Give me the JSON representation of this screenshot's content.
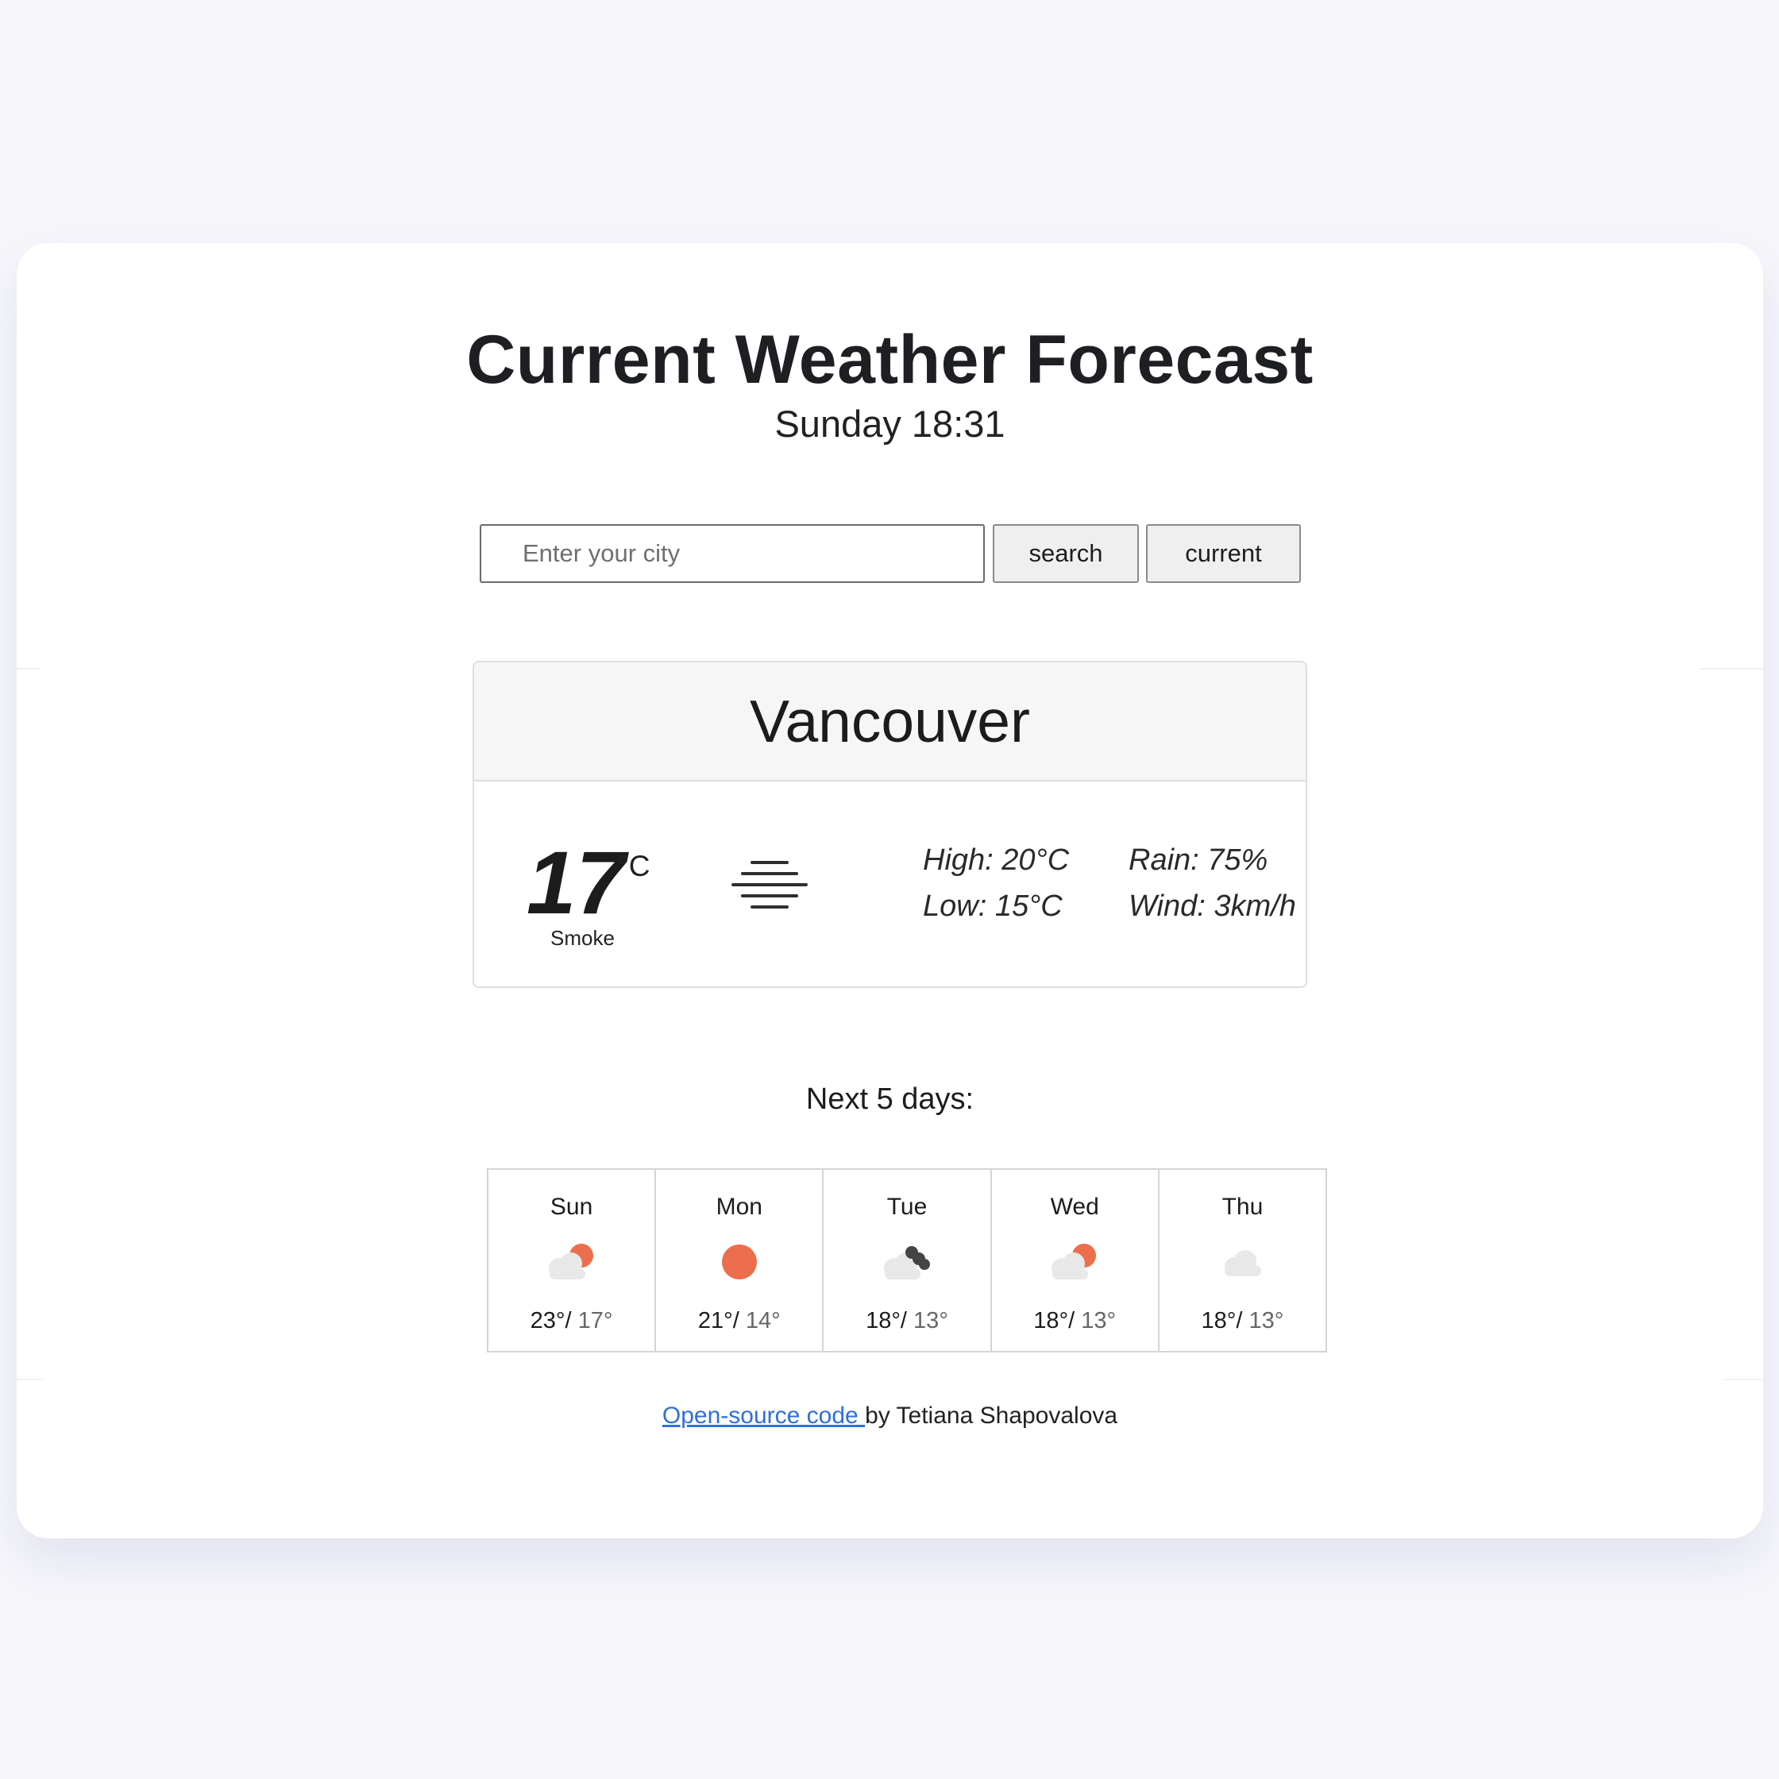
{
  "header": {
    "title": "Current Weather Forecast",
    "datetime": "Sunday 18:31"
  },
  "search": {
    "placeholder": "Enter your city",
    "value": "",
    "search_label": "search",
    "current_label": "current"
  },
  "current": {
    "city": "Vancouver",
    "temperature": "17",
    "unit": "°C",
    "description": "Smoke",
    "icon": "fog-icon",
    "high": "High: 20°C",
    "low": "Low: 15°C",
    "rain": "Rain: 75%",
    "wind": "Wind: 3km/h"
  },
  "forecast": {
    "title": "Next 5 days:",
    "days": [
      {
        "day": "Sun",
        "icon": "partly-cloudy-icon",
        "max": "23°/",
        "min": " 17°"
      },
      {
        "day": "Mon",
        "icon": "sun-icon",
        "max": "21°/",
        "min": " 14°"
      },
      {
        "day": "Tue",
        "icon": "broken-clouds-icon",
        "max": "18°/",
        "min": " 13°"
      },
      {
        "day": "Wed",
        "icon": "partly-cloudy-icon",
        "max": "18°/",
        "min": " 13°"
      },
      {
        "day": "Thu",
        "icon": "cloud-icon",
        "max": "18°/",
        "min": " 13°"
      }
    ]
  },
  "footer": {
    "link_text": "Open-source code ",
    "author_text": "by Tetiana Shapovalova"
  },
  "colors": {
    "page_background": "#f6f6fb",
    "card_background": "#ffffff",
    "sun": "#ec6e4c",
    "cloud": "#e8e8e8",
    "dark_cloud": "#444444",
    "link": "#2f6fd8"
  }
}
